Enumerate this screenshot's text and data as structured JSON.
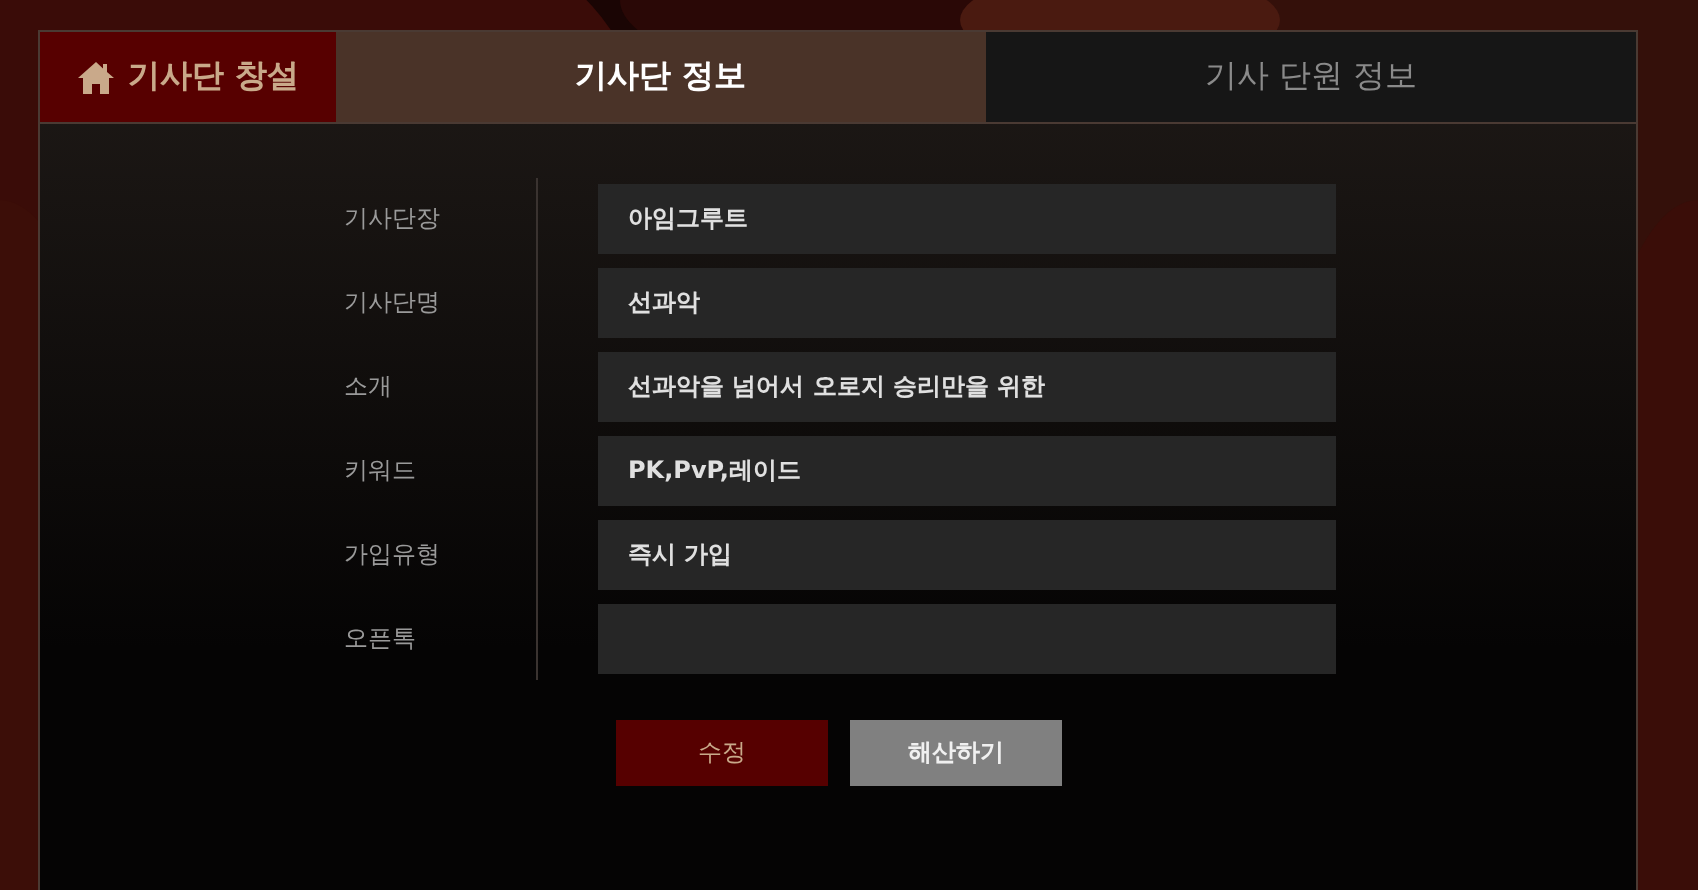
{
  "tabs": [
    {
      "label": "기사단 창설",
      "kind": "action",
      "selected": false
    },
    {
      "label": "기사단 정보",
      "kind": "tab",
      "selected": true
    },
    {
      "label": "기사 단원 정보",
      "kind": "tab",
      "selected": false
    }
  ],
  "fields": [
    {
      "label": "기사단장",
      "value": "아임그루트"
    },
    {
      "label": "기사단명",
      "value": "선과악"
    },
    {
      "label": "소개",
      "value": "선과악을 넘어서 오로지 승리만을 위한"
    },
    {
      "label": "키워드",
      "value": "PK,PvP,레이드"
    },
    {
      "label": "가입유형",
      "value": "즉시 가입"
    },
    {
      "label": "오픈톡"
    }
  ],
  "buttons": [
    {
      "label": "수정",
      "kind": "primary"
    },
    {
      "label": "해산하기",
      "kind": "secondary"
    }
  ]
}
